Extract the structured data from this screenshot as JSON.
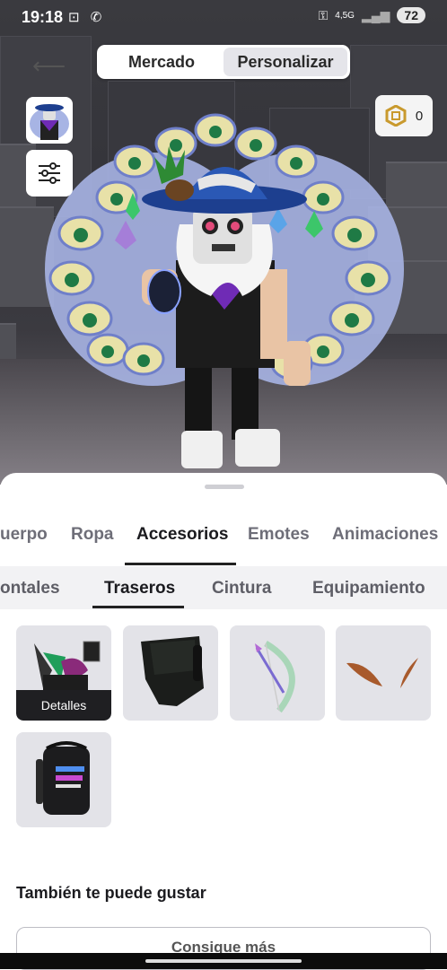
{
  "status_bar": {
    "time": "19:18",
    "network": "4,5G",
    "battery": "72"
  },
  "top_tabs": {
    "market": "Mercado",
    "customize": "Personalizar"
  },
  "currency": {
    "robux_balance": "0"
  },
  "category_tabs": [
    "uerpo",
    "Ropa",
    "Accesorios",
    "Emotes",
    "Animaciones"
  ],
  "subcategory_tabs": [
    "ontales",
    "Traseros",
    "Cintura",
    "Equipamiento"
  ],
  "items": [
    {
      "icon": "wings-pack-icon",
      "badge": "Detalles"
    },
    {
      "icon": "dark-backpack-icon"
    },
    {
      "icon": "bow-icon"
    },
    {
      "icon": "bronze-wings-icon"
    },
    {
      "icon": "build-backpack-icon"
    }
  ],
  "recommend": {
    "title": "También te puede gustar",
    "button": "Consigue más"
  },
  "colors": {
    "accent": "#1b1b1f",
    "sheet": "#ffffff",
    "tile": "#e3e3e8"
  }
}
